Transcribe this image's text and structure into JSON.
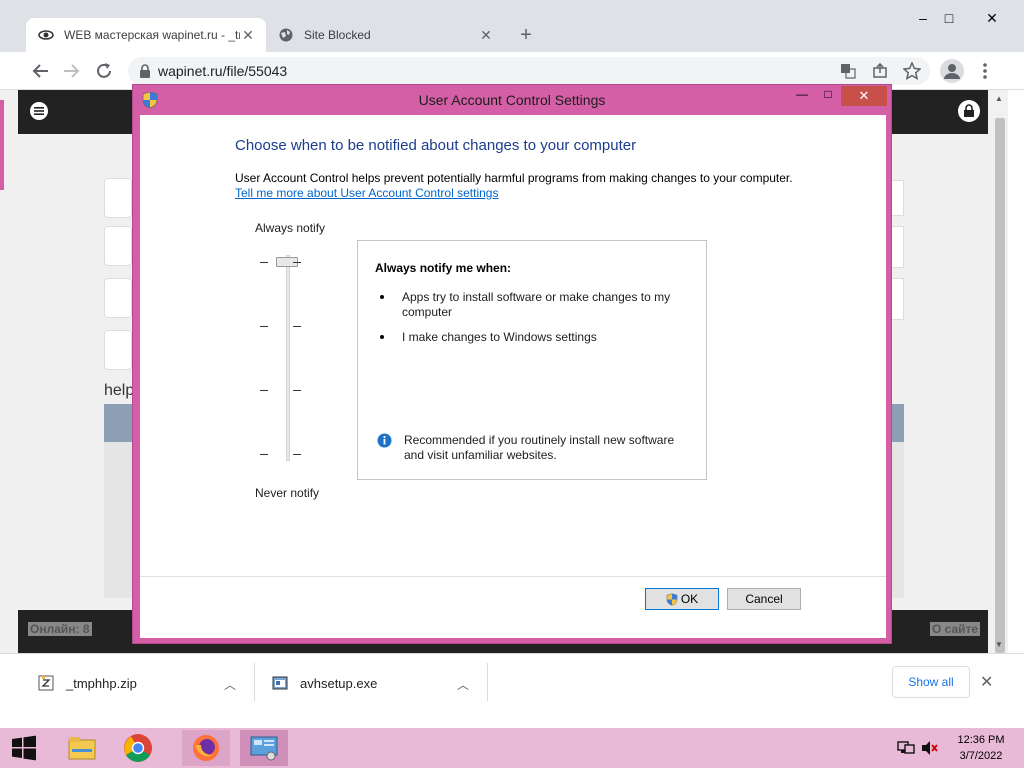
{
  "browser": {
    "tabs": [
      {
        "label": "WEB мастерская wapinet.ru - _tm"
      },
      {
        "label": "Site Blocked"
      }
    ],
    "url": "wapinet.ru/file/55043"
  },
  "webpage": {
    "partial_text": "help",
    "footer_left": "Онлайн: 8",
    "footer_right": "О сайте"
  },
  "dialog": {
    "title": "User Account Control Settings",
    "heading": "Choose when to be notified about changes to your computer",
    "description": "User Account Control helps prevent potentially harmful programs from making changes to your computer.",
    "learn_more": "Tell me more about User Account Control settings",
    "slider": {
      "top_label": "Always notify",
      "bottom_label": "Never notify",
      "level_index": 0,
      "levels": 4
    },
    "info": {
      "heading": "Always notify me when:",
      "bullets": [
        "Apps try to install software or make changes to my computer",
        "I make changes to Windows settings"
      ],
      "recommendation": "Recommended if you routinely install new software and visit unfamiliar websites."
    },
    "ok_label": "OK",
    "cancel_label": "Cancel"
  },
  "downloads": {
    "items": [
      {
        "name": "_tmphhp.zip"
      },
      {
        "name": "avhsetup.exe"
      }
    ],
    "show_all": "Show all"
  },
  "taskbar": {
    "time": "12:36 PM",
    "date": "3/7/2022"
  },
  "colors": {
    "dialog_frame": "#d45fa6",
    "taskbar": "#e9b9d8",
    "heading": "#1c3d8c",
    "link": "#0066cc"
  }
}
